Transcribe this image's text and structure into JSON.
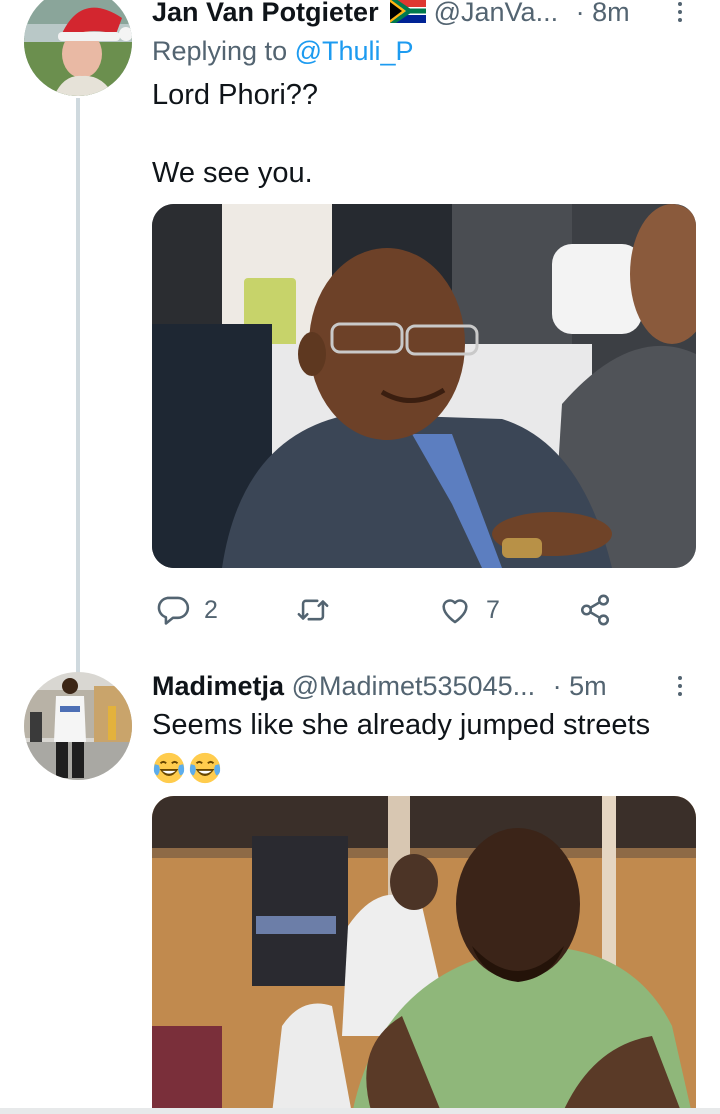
{
  "tweets": [
    {
      "name": "Jan Van Potgieter",
      "flag": "south-africa-flag",
      "handle": "@JanVa...",
      "separator": "·",
      "time": "8m",
      "reply_label": "Replying to",
      "reply_to": "@Thuli_P",
      "text_line1": "Lord Phori??",
      "text_line2": "We see you.",
      "avatar": "man-in-santa-hat-photo",
      "media": "smiling-man-in-glasses-photo",
      "actions": {
        "reply_count": "2",
        "retweet_count": "",
        "like_count": "7"
      }
    },
    {
      "name": "Madimetja",
      "handle": "@Madimet535045...",
      "separator": "·",
      "time": "5m",
      "text": "Seems like she already jumped streets",
      "emoji": [
        "face-with-tears-of-joy",
        "face-with-tears-of-joy"
      ],
      "avatar": "man-in-white-tshirt-photo",
      "media": "man-in-green-shirt-eyes-closed-photo"
    }
  ],
  "icons": {
    "reply": "reply-icon",
    "retweet": "retweet-icon",
    "like": "heart-icon",
    "share": "share-icon",
    "more": "more-vertical-icon"
  },
  "colors": {
    "link": "#1d9bf0",
    "secondary_text": "#536471",
    "thread_line": "#cfd9de"
  }
}
